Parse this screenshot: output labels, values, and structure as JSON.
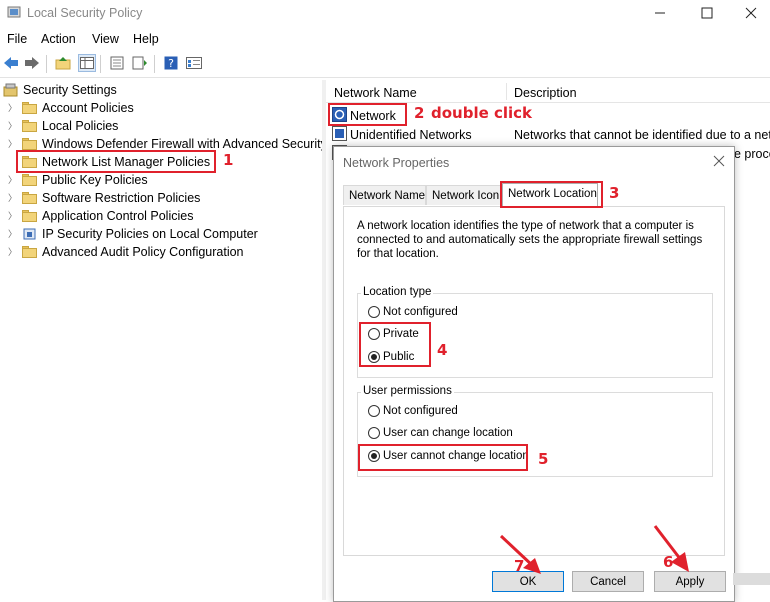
{
  "window": {
    "title": "Local Security Policy"
  },
  "menu": [
    "File",
    "Action",
    "View",
    "Help"
  ],
  "toolbar": {
    "icons": [
      "back-icon",
      "forward-icon",
      "up-folder-icon",
      "show-hide-tree-icon",
      "properties-icon",
      "export-list-icon",
      "help-icon",
      "view-icon"
    ]
  },
  "tree": {
    "root": "Security Settings",
    "items": [
      "Account Policies",
      "Local Policies",
      "Windows Defender Firewall with Advanced Security",
      "Network List Manager Policies",
      "Public Key Policies",
      "Software Restriction Policies",
      "Application Control Policies",
      "IP Security Policies on Local Computer",
      "Advanced Audit Policy Configuration"
    ]
  },
  "list": {
    "columns": [
      "Network Name",
      "Description"
    ],
    "rows": [
      {
        "name": "Network",
        "desc": ""
      },
      {
        "name": "Unidentified Networks",
        "desc": "Networks that cannot be identified due to a netw"
      },
      {
        "name": "",
        "desc": "e proce"
      }
    ]
  },
  "dialog": {
    "title": "Network Properties",
    "tabs": [
      "Network Name",
      "Network Icon",
      "Network Location"
    ],
    "description": "A network location identifies the type of network that a computer is connected to and automatically sets the appropriate firewall settings for that location.",
    "location_group": {
      "label": "Location type",
      "options": [
        "Not configured",
        "Private",
        "Public"
      ],
      "selected": "Public"
    },
    "permissions_group": {
      "label": "User permissions",
      "options": [
        "Not configured",
        "User can change location",
        "User cannot change location"
      ],
      "selected": "User cannot change location"
    },
    "buttons": {
      "ok": "OK",
      "cancel": "Cancel",
      "apply": "Apply"
    }
  },
  "annotations": {
    "step1": "1",
    "step2": "2",
    "step2_text": "double click",
    "step3": "3",
    "step4": "4",
    "step5": "5",
    "step6": "6",
    "step7": "7",
    "color": "#e0212c"
  }
}
